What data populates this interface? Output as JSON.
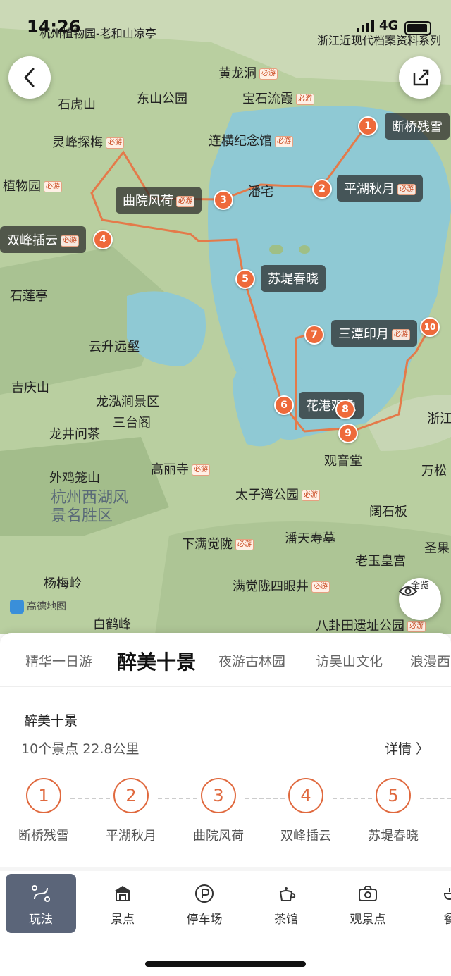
{
  "status_bar": {
    "time": "14:26",
    "network": "4G"
  },
  "map": {
    "labels": [
      {
        "text": "杭州植物园-老和山凉亭"
      },
      {
        "text": "浙江近现代档案资料系列"
      },
      {
        "text": "黄龙洞",
        "must": "必游"
      },
      {
        "text": "东山公园"
      },
      {
        "text": "宝石流霞",
        "must": "必游"
      },
      {
        "text": "石虎山"
      },
      {
        "text": "灵峰探梅",
        "must": "必游"
      },
      {
        "text": "连横纪念馆",
        "must": "必游"
      },
      {
        "text": "植物园",
        "must": "必游"
      },
      {
        "text": "潘宅"
      },
      {
        "text": "石莲亭"
      },
      {
        "text": "云升远壑"
      },
      {
        "text": "吉庆山"
      },
      {
        "text": "龙泓涧景区"
      },
      {
        "text": "三台阁"
      },
      {
        "text": "龙井问茶"
      },
      {
        "text": "外鸡笼山"
      },
      {
        "text": "高丽寺",
        "must": "必游"
      },
      {
        "text": "杭州西湖风景名胜区"
      },
      {
        "text": "太子湾公园",
        "must": "必游"
      },
      {
        "text": "观音堂"
      },
      {
        "text": "阔石板"
      },
      {
        "text": "下满觉陇",
        "must": "必游"
      },
      {
        "text": "潘天寿墓"
      },
      {
        "text": "老玉皇宫"
      },
      {
        "text": "杨梅岭"
      },
      {
        "text": "满觉陇四眼井",
        "must": "必游"
      },
      {
        "text": "白鹤峰"
      },
      {
        "text": "八卦田遗址公园",
        "must": "必游"
      },
      {
        "text": "浙江"
      },
      {
        "text": "万松"
      },
      {
        "text": "圣果"
      }
    ],
    "spots": [
      {
        "num": "1",
        "name": "断桥残雪"
      },
      {
        "num": "2",
        "name": "平湖秋月",
        "must": "必游"
      },
      {
        "num": "3",
        "name": "曲院风荷",
        "must": "必游"
      },
      {
        "num": "4",
        "name": "双峰插云",
        "must": "必游"
      },
      {
        "num": "5",
        "name": "苏堤春晓"
      },
      {
        "num": "7",
        "name": "三潭印月",
        "must": "必游"
      },
      {
        "num": "8",
        "name": "花港观鱼"
      }
    ],
    "markers": [
      "1",
      "2",
      "3",
      "4",
      "5",
      "6",
      "7",
      "8",
      "9",
      "10"
    ],
    "logo": "高德地图",
    "full_view_label": "全览",
    "colors": {
      "lake": "#8fc9d4",
      "land": "#b9cfa0",
      "route": "#e47a4a",
      "marker": "#ee6a3b"
    }
  },
  "tabs": [
    "精华一日游",
    "醉美十景",
    "夜游古林园",
    "访吴山文化",
    "浪漫西"
  ],
  "route": {
    "title": "醉美十景",
    "summary": "10个景点  22.8公里",
    "detail_label": "详情 〉",
    "stops": [
      {
        "num": "1",
        "name": "断桥残雪"
      },
      {
        "num": "2",
        "name": "平湖秋月"
      },
      {
        "num": "3",
        "name": "曲院风荷"
      },
      {
        "num": "4",
        "name": "双峰插云"
      },
      {
        "num": "5",
        "name": "苏堤春晓"
      }
    ]
  },
  "bottom_nav": [
    {
      "label": "玩法",
      "icon": "route-icon"
    },
    {
      "label": "景点",
      "icon": "landmark-icon"
    },
    {
      "label": "停车场",
      "icon": "parking-icon"
    },
    {
      "label": "茶馆",
      "icon": "teapot-icon"
    },
    {
      "label": "观景点",
      "icon": "camera-icon"
    },
    {
      "label": "餐",
      "icon": "dining-icon"
    }
  ]
}
